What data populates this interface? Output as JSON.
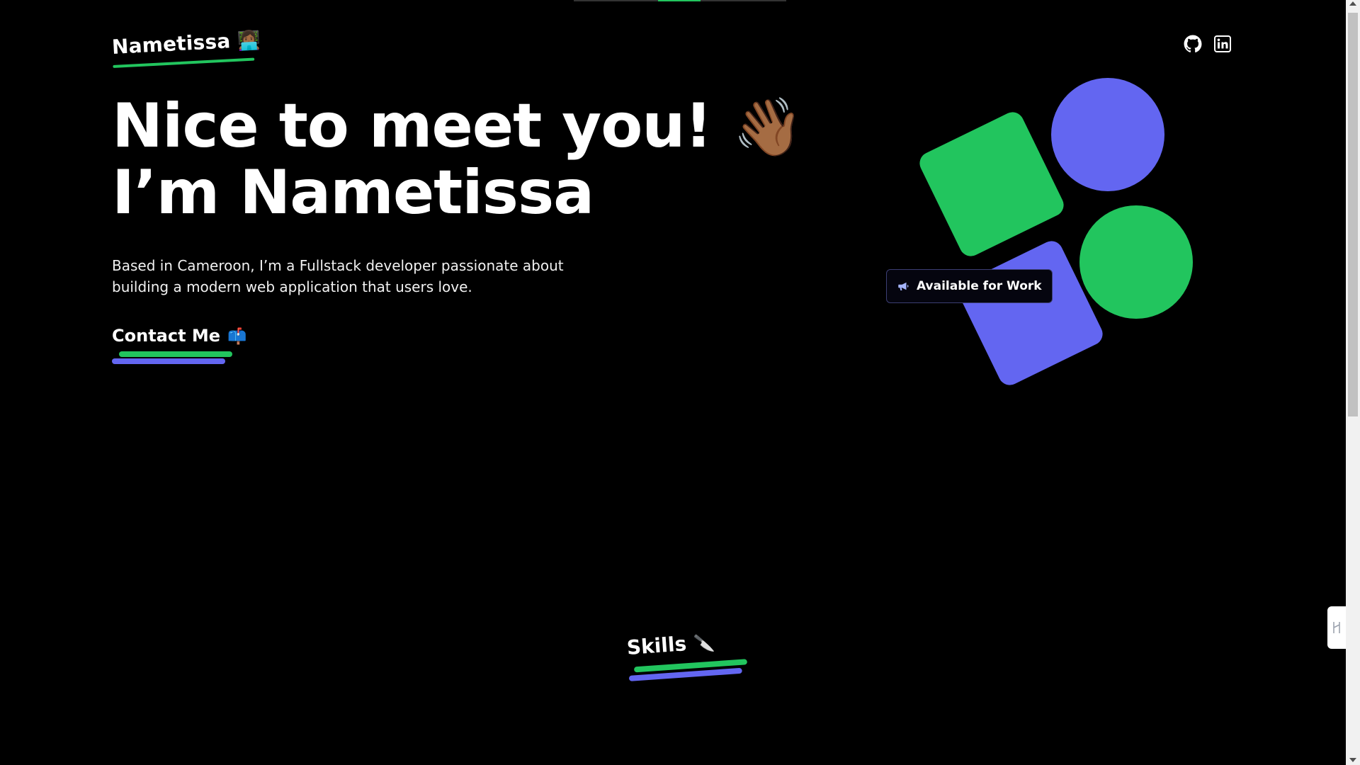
{
  "header": {
    "logo_text": "Nametissa",
    "logo_emoji": "👩🏾‍💻",
    "social": [
      {
        "icon": "github-icon",
        "label": "GitHub"
      },
      {
        "icon": "linkedin-icon",
        "label": "LinkedIn"
      }
    ]
  },
  "hero": {
    "title_line1": "Nice to meet you!",
    "title_emoji": "👋🏾",
    "title_line2": "I’m Nametissa",
    "description": "Based in Cameroon, I’m a Fullstack developer passionate about building a modern web application that users love.",
    "contact_label": "Contact Me",
    "contact_emoji": "📫",
    "available_label": "Available for Work",
    "available_icon": "megaphone-icon"
  },
  "skills": {
    "label": "Skills",
    "emoji": "🔪"
  },
  "colors": {
    "background": "#000000",
    "green": "#22c55e",
    "indigo": "#6366f1",
    "text": "#ffffff"
  }
}
